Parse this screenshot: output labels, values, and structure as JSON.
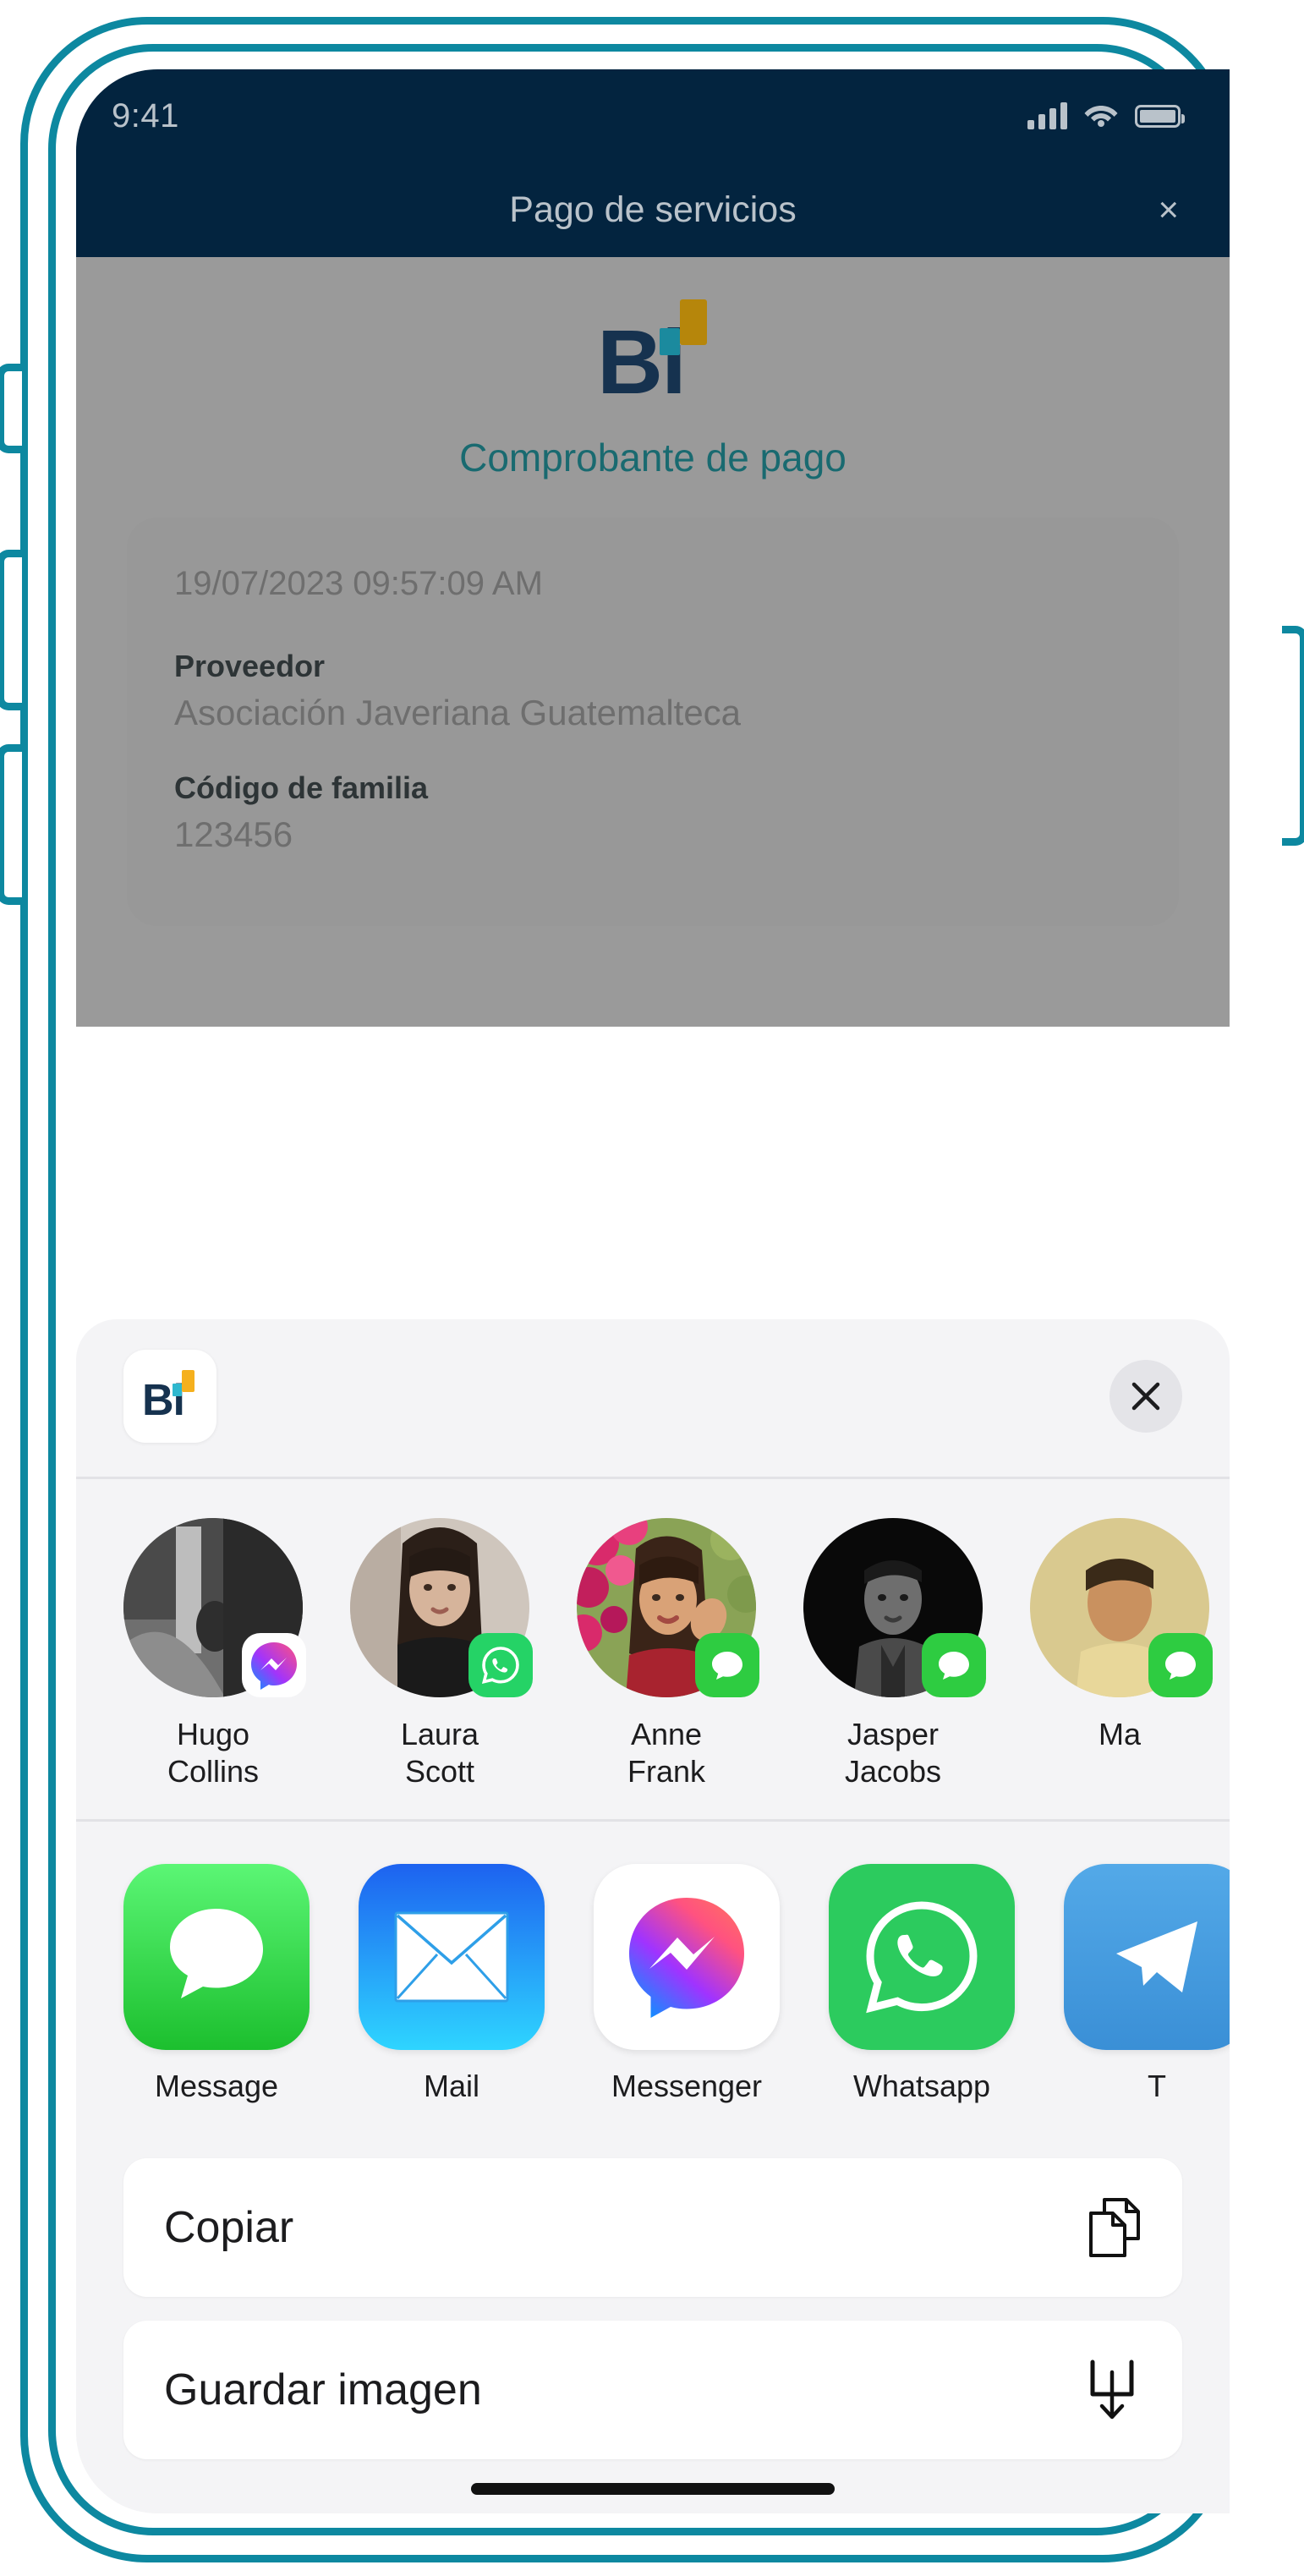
{
  "status_bar": {
    "time": "9:41",
    "signal_icon": "cellular-signal-icon",
    "wifi_icon": "wifi-icon",
    "battery_icon": "battery-icon"
  },
  "app_header": {
    "title": "Pago de servicios",
    "close_label": "×"
  },
  "receipt": {
    "brand_mark": "Bi",
    "subtitle": "Comprobante de pago",
    "timestamp": "19/07/2023 09:57:09 AM",
    "fields": [
      {
        "label": "Proveedor",
        "value": "Asociación Javeriana Guatemalteca"
      },
      {
        "label": "Código de familia",
        "value": "123456"
      }
    ]
  },
  "share_sheet": {
    "app_icon_mark": "Bi",
    "close_label": "×",
    "contacts": [
      {
        "first_name": "Hugo",
        "last_name": "Collins",
        "badge": "messenger"
      },
      {
        "first_name": "Laura",
        "last_name": "Scott",
        "badge": "whatsapp"
      },
      {
        "first_name": "Anne",
        "last_name": "Frank",
        "badge": "message"
      },
      {
        "first_name": "Jasper",
        "last_name": "Jacobs",
        "badge": "message"
      },
      {
        "first_name": "Ma",
        "last_name": "",
        "badge": "message"
      }
    ],
    "apps": [
      {
        "label": "Message",
        "icon": "messages-app-icon"
      },
      {
        "label": "Mail",
        "icon": "mail-app-icon"
      },
      {
        "label": "Messenger",
        "icon": "messenger-app-icon"
      },
      {
        "label": "Whatsapp",
        "icon": "whatsapp-app-icon"
      },
      {
        "label": "T",
        "icon": "telegram-app-icon"
      }
    ],
    "actions": [
      {
        "label": "Copiar",
        "icon": "copy-icon"
      },
      {
        "label": "Guardar imagen",
        "icon": "download-icon"
      }
    ]
  },
  "colors": {
    "phone_frame": "#0d88a0",
    "header_navy": "#03243f",
    "brand_navy": "#16324f",
    "brand_gold": "#b6860b",
    "brand_teal": "#1b8a9e",
    "subtitle_teal": "#196a70",
    "sheet_bg": "#f4f4f6",
    "whatsapp_green": "#25D366",
    "message_green": "#2ecc41"
  }
}
